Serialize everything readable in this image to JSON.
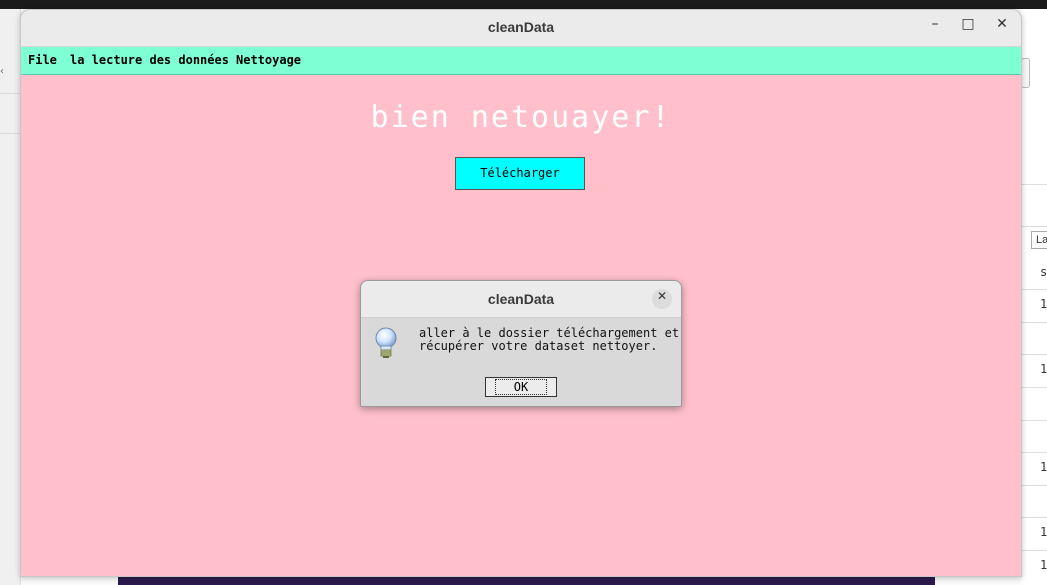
{
  "os_topbar": {
    "text": ""
  },
  "background_app": {
    "small_input_text": "La",
    "column_header": "s",
    "cells": [
      "1",
      "1",
      "1",
      "1",
      "1"
    ]
  },
  "window": {
    "title": "cleanData",
    "controls": {
      "minimize": "–",
      "maximize": "□",
      "close": "✕"
    },
    "menu": [
      "File",
      "la lecture des données",
      "Nettoyage"
    ],
    "heading": "bien netouayer!",
    "download_button": "Télécharger",
    "background_color": "#ffc0cb",
    "menubar_color": "#7fffd4",
    "button_color": "#00ffff"
  },
  "dialog": {
    "title": "cleanData",
    "close": "✕",
    "icon": "lightbulb-icon",
    "message_lines": [
      "aller à le dossier téléchargement et",
      "récupérer votre dataset nettoyer."
    ],
    "ok_label": "OK"
  }
}
